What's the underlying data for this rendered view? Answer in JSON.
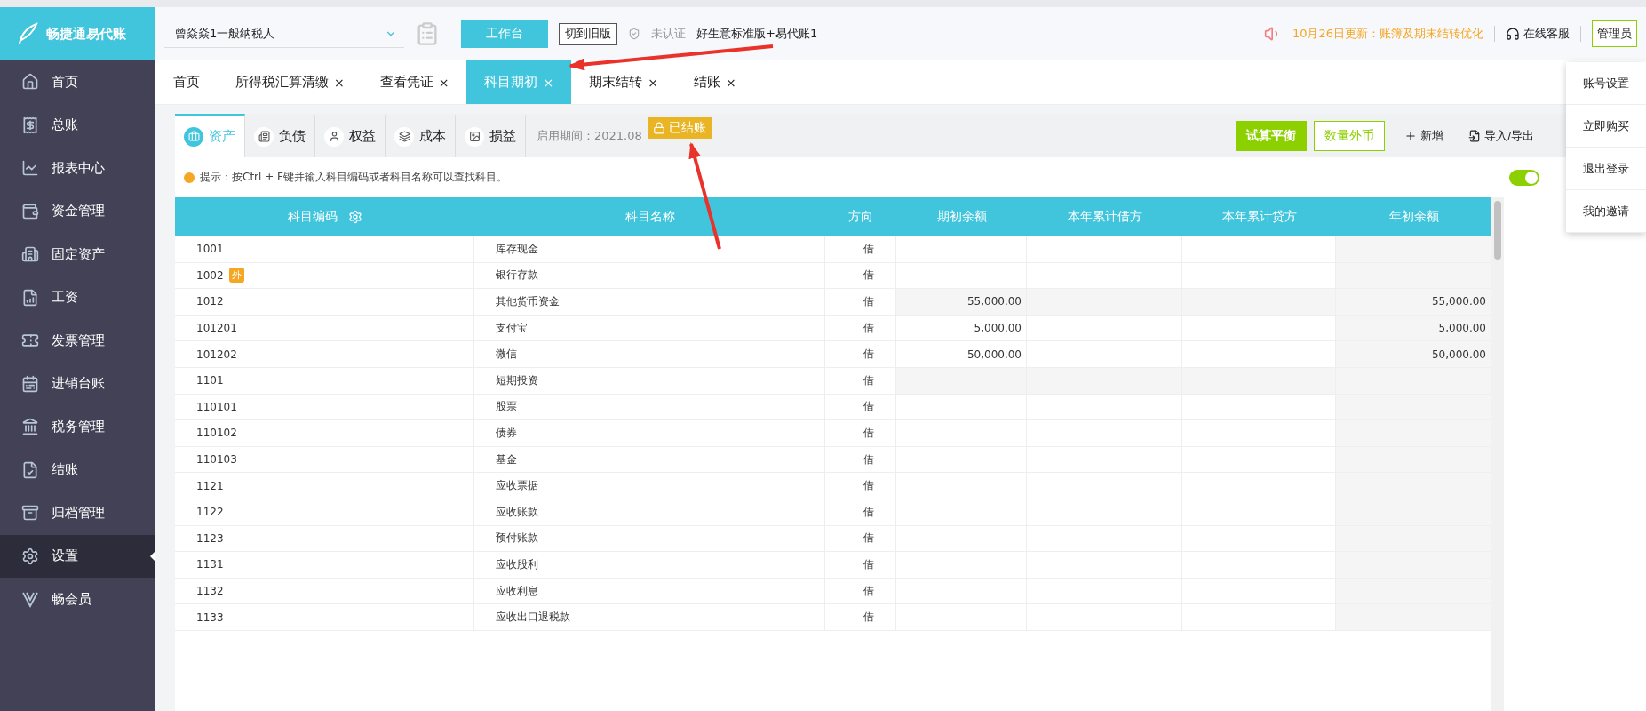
{
  "brand": {
    "name": "畅捷通易代账"
  },
  "company": {
    "value": "曾焱焱1一般纳税人"
  },
  "topbar": {
    "workbench": "工作台",
    "old_version": "切到旧版",
    "cert": "未认证",
    "edition": "好生意标准版+易代账1",
    "notice": "10月26日更新：账簿及期末结转优化",
    "service": "在线客服",
    "admin": "管理员"
  },
  "sidebar": {
    "items": [
      {
        "label": "首页",
        "selected": false
      },
      {
        "label": "总账",
        "selected": false
      },
      {
        "label": "报表中心",
        "selected": false
      },
      {
        "label": "资金管理",
        "selected": false
      },
      {
        "label": "固定资产",
        "selected": false
      },
      {
        "label": "工资",
        "selected": false
      },
      {
        "label": "发票管理",
        "selected": false
      },
      {
        "label": "进销台账",
        "selected": false
      },
      {
        "label": "税务管理",
        "selected": false
      },
      {
        "label": "结账",
        "selected": false
      },
      {
        "label": "归档管理",
        "selected": false
      },
      {
        "label": "设置",
        "selected": true
      },
      {
        "label": "畅会员",
        "selected": false
      }
    ]
  },
  "tabs": [
    {
      "label": "首页",
      "selected": false
    },
    {
      "label": "所得税汇算清缴",
      "close": "×",
      "selected": false
    },
    {
      "label": "查看凭证",
      "close": "×",
      "selected": false
    },
    {
      "label": "科目期初",
      "close": "×",
      "selected": true
    },
    {
      "label": "期末结转",
      "close": "×",
      "selected": false
    },
    {
      "label": "结账",
      "close": "×",
      "selected": false
    }
  ],
  "subtabs": [
    {
      "label": "资产",
      "selected": true
    },
    {
      "label": "负债",
      "selected": false
    },
    {
      "label": "权益",
      "selected": false
    },
    {
      "label": "成本",
      "selected": false
    },
    {
      "label": "损益",
      "selected": false
    }
  ],
  "period": "启用期间：2021.08",
  "closed_badge": "已结账",
  "actions": {
    "trial": "试算平衡",
    "qty": "数量外币",
    "add": "新增",
    "import": "导入/导出"
  },
  "tip": "提示：按Ctrl + F键并输入科目编码或者科目名称可以查找科目。",
  "toggle": {
    "on": true
  },
  "user_menu": [
    "账号设置",
    "立即购买",
    "退出登录",
    "我的邀请"
  ],
  "table": {
    "columns": [
      "科目编码",
      "科目名称",
      "方向",
      "期初余额",
      "本年累计借方",
      "本年累计贷方",
      "年初余额"
    ],
    "rows": [
      {
        "code": "1001",
        "name": "库存现金",
        "dir": "借",
        "kind": "leaf",
        "opening": "",
        "debit": "",
        "credit": "",
        "year_start": ""
      },
      {
        "code": "1002",
        "badge": "外",
        "name": "银行存款",
        "dir": "借",
        "kind": "leaf",
        "opening": "",
        "debit": "",
        "credit": "",
        "year_start": ""
      },
      {
        "code": "1012",
        "name": "其他货币资金",
        "dir": "借",
        "kind": "parent",
        "opening": "55,000.00",
        "debit": "",
        "credit": "",
        "year_start": "55,000.00"
      },
      {
        "code": "101201",
        "name": "支付宝",
        "dir": "借",
        "kind": "leaf",
        "opening": "5,000.00",
        "debit": "",
        "credit": "",
        "year_start": "5,000.00"
      },
      {
        "code": "101202",
        "name": "微信",
        "dir": "借",
        "kind": "leaf",
        "opening": "50,000.00",
        "debit": "",
        "credit": "",
        "year_start": "50,000.00"
      },
      {
        "code": "1101",
        "name": "短期投资",
        "dir": "借",
        "kind": "parent",
        "opening": "",
        "debit": "",
        "credit": "",
        "year_start": ""
      },
      {
        "code": "110101",
        "name": "股票",
        "dir": "借",
        "kind": "leaf",
        "opening": "",
        "debit": "",
        "credit": "",
        "year_start": ""
      },
      {
        "code": "110102",
        "name": "债券",
        "dir": "借",
        "kind": "leaf",
        "opening": "",
        "debit": "",
        "credit": "",
        "year_start": ""
      },
      {
        "code": "110103",
        "name": "基金",
        "dir": "借",
        "kind": "leaf",
        "opening": "",
        "debit": "",
        "credit": "",
        "year_start": ""
      },
      {
        "code": "1121",
        "name": "应收票据",
        "dir": "借",
        "kind": "leaf",
        "opening": "",
        "debit": "",
        "credit": "",
        "year_start": ""
      },
      {
        "code": "1122",
        "name": "应收账款",
        "dir": "借",
        "kind": "leaf",
        "opening": "",
        "debit": "",
        "credit": "",
        "year_start": ""
      },
      {
        "code": "1123",
        "name": "预付账款",
        "dir": "借",
        "kind": "leaf",
        "opening": "",
        "debit": "",
        "credit": "",
        "year_start": ""
      },
      {
        "code": "1131",
        "name": "应收股利",
        "dir": "借",
        "kind": "leaf",
        "opening": "",
        "debit": "",
        "credit": "",
        "year_start": ""
      },
      {
        "code": "1132",
        "name": "应收利息",
        "dir": "借",
        "kind": "leaf",
        "opening": "",
        "debit": "",
        "credit": "",
        "year_start": ""
      },
      {
        "code": "1133",
        "name": "应收出口退税款",
        "dir": "借",
        "kind": "leaf",
        "opening": "",
        "debit": "",
        "credit": "",
        "year_start": ""
      }
    ]
  }
}
